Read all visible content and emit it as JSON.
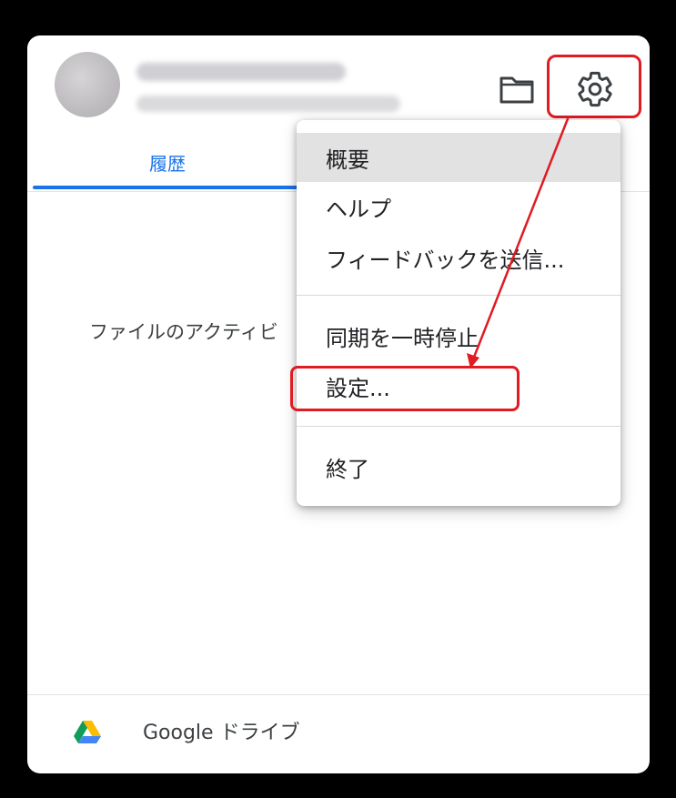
{
  "header": {
    "folder_icon": "folder-icon",
    "settings_icon": "gear-icon"
  },
  "tabs": [
    {
      "label": "履歴",
      "active": true
    }
  ],
  "main": {
    "activity_text": "ファイルのアクティビ"
  },
  "menu": {
    "items": [
      {
        "label": "概要"
      },
      {
        "label": "ヘルプ"
      },
      {
        "label": "フィードバックを送信..."
      },
      {
        "label": "同期を一時停止"
      },
      {
        "label": "設定..."
      },
      {
        "label": "終了"
      }
    ]
  },
  "footer": {
    "label": "Google ドライブ",
    "logo": "google-drive-logo"
  },
  "colors": {
    "accent": "#1a73e8",
    "annotation": "#e01b22",
    "menu_hover": "#e2e2e2"
  }
}
